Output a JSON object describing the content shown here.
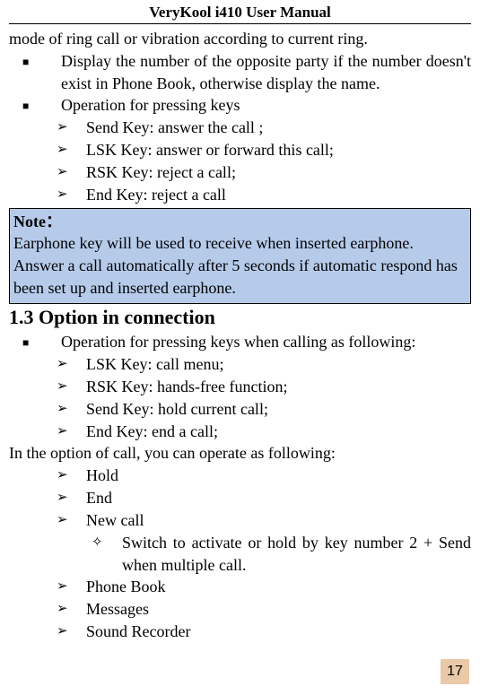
{
  "header": {
    "title": "VeryKool i410 User Manual"
  },
  "body": {
    "intro_line": "mode of ring call or vibration according to current ring.",
    "bullets1": [
      "Display the number of the opposite party if the number doesn't exist in Phone Book, otherwise display the name.",
      "Operation for pressing keys"
    ],
    "sub_bullets1": [
      "Send Key: answer the call ;",
      "LSK Key: answer or forward this call;",
      "RSK Key: reject a call;",
      "End Key: reject a call"
    ],
    "note": {
      "label": "Note：",
      "line1": "Earphone key will be used to receive when inserted earphone.",
      "line2": "Answer a call automatically after 5 seconds if automatic respond has been set up and inserted earphone."
    },
    "section_heading": "1.3 Option in connection",
    "bullets2": [
      "Operation for pressing keys when calling as following:"
    ],
    "sub_bullets2": [
      "LSK Key: call menu;",
      "RSK Key: hands-free function;",
      "Send Key: hold current call;",
      "End Key: end a call;"
    ],
    "mid_line": "In the option of call, you can operate as following:",
    "sub_bullets3": [
      "Hold",
      "End",
      "New call"
    ],
    "diamond_bullets": [
      "Switch to activate or hold by key number 2 + Send when multiple call."
    ],
    "sub_bullets4": [
      "Phone Book",
      "Messages",
      "Sound Recorder"
    ]
  },
  "page_number": "17"
}
